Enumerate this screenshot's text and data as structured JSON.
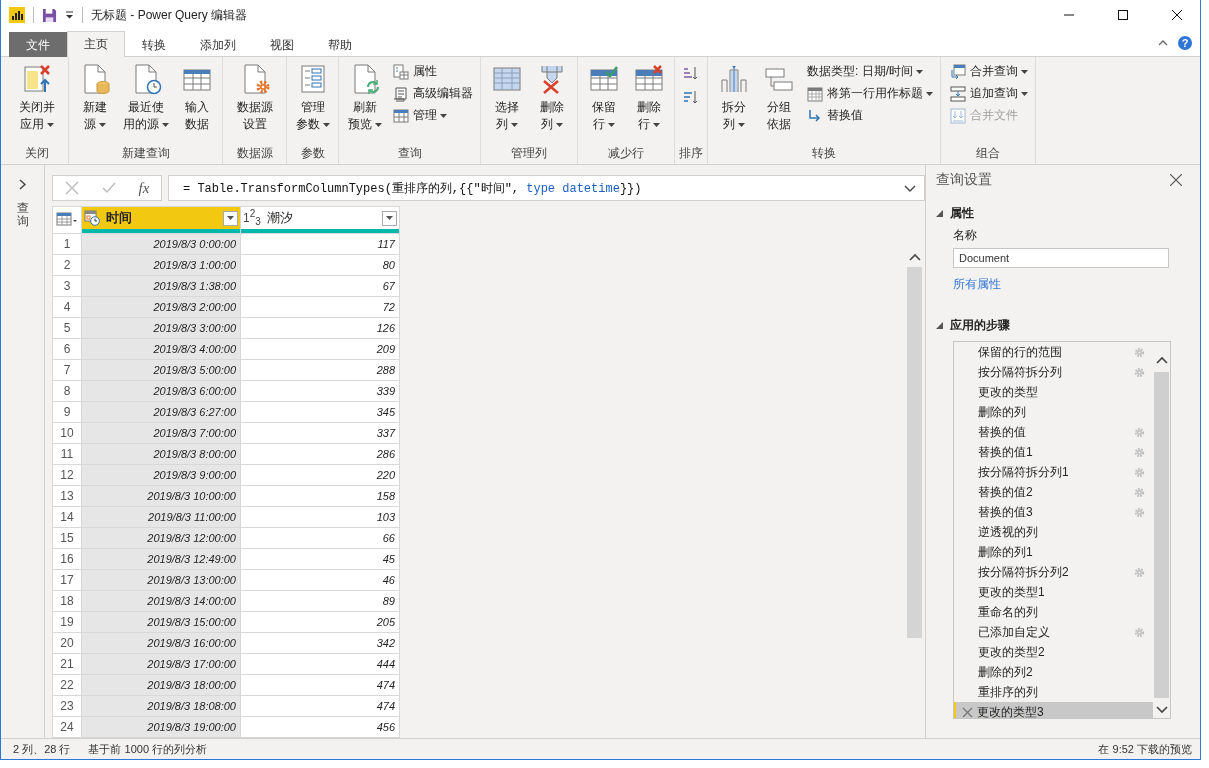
{
  "window": {
    "title": "无标题 - Power Query 编辑器"
  },
  "tabs": [
    {
      "label": "文件",
      "kind": "file",
      "selected": false
    },
    {
      "label": "主页",
      "kind": "tab",
      "selected": true
    },
    {
      "label": "转换",
      "kind": "tab",
      "selected": false
    },
    {
      "label": "添加列",
      "kind": "tab",
      "selected": false
    },
    {
      "label": "视图",
      "kind": "tab",
      "selected": false
    },
    {
      "label": "帮助",
      "kind": "tab",
      "selected": false
    }
  ],
  "help": "?",
  "ribbon": [
    {
      "label": "关闭",
      "items": [
        {
          "kind": "large",
          "label": "关闭并应用",
          "dropdown": true,
          "disabled": false
        }
      ]
    },
    {
      "label": "新建查询",
      "items": [
        {
          "kind": "large",
          "label": "新建源",
          "dropdown": true,
          "disabled": false
        },
        {
          "kind": "large",
          "label": "最近使用的源",
          "dropdown": true,
          "disabled": false
        },
        {
          "kind": "large",
          "label": "输入数据",
          "dropdown": false,
          "disabled": false
        }
      ]
    },
    {
      "label": "数据源",
      "items": [
        {
          "kind": "large",
          "label": "数据源设置",
          "dropdown": false,
          "disabled": false
        }
      ]
    },
    {
      "label": "参数",
      "items": [
        {
          "kind": "large",
          "label": "管理参数",
          "dropdown": true,
          "disabled": false
        }
      ]
    },
    {
      "label": "查询",
      "items": [
        {
          "kind": "large",
          "label": "刷新预览",
          "dropdown": true,
          "disabled": false
        },
        {
          "kind": "small",
          "label": "属性",
          "dropdown": false,
          "disabled": false
        },
        {
          "kind": "small",
          "label": "高级编辑器",
          "dropdown": false,
          "disabled": false
        },
        {
          "kind": "small",
          "label": "管理",
          "dropdown": true,
          "disabled": false
        }
      ]
    },
    {
      "label": "管理列",
      "items": [
        {
          "kind": "large",
          "label": "选择列",
          "dropdown": true,
          "disabled": false
        },
        {
          "kind": "large",
          "label": "删除列",
          "dropdown": true,
          "disabled": false
        }
      ]
    },
    {
      "label": "减少行",
      "items": [
        {
          "kind": "large",
          "label": "保留行",
          "dropdown": true,
          "disabled": false
        },
        {
          "kind": "large",
          "label": "删除行",
          "dropdown": true,
          "disabled": false
        }
      ]
    },
    {
      "label": "排序",
      "items": [
        {
          "kind": "icon",
          "dropdown": false,
          "disabled": false
        },
        {
          "kind": "icon",
          "dropdown": false,
          "disabled": false
        }
      ]
    },
    {
      "label": "转换",
      "items": [
        {
          "kind": "large",
          "label": "拆分列",
          "dropdown": true,
          "disabled": false
        },
        {
          "kind": "large",
          "label": "分组依据",
          "dropdown": false,
          "disabled": false
        },
        {
          "kind": "small",
          "label": "数据类型: 日期/时间",
          "dropdown": true,
          "disabled": false
        },
        {
          "kind": "small",
          "label": "将第一行用作标题",
          "dropdown": true,
          "disabled": false
        },
        {
          "kind": "small",
          "label": "替换值",
          "dropdown": false,
          "disabled": false
        }
      ]
    },
    {
      "label": "组合",
      "items": [
        {
          "kind": "small",
          "label": "合并查询",
          "dropdown": true,
          "disabled": false
        },
        {
          "kind": "small",
          "label": "追加查询",
          "dropdown": true,
          "disabled": false
        },
        {
          "kind": "small",
          "label": "合并文件",
          "dropdown": false,
          "disabled": true
        }
      ]
    }
  ],
  "queries_pane": {
    "label": "查询"
  },
  "formula_bar": {
    "fx": "fx",
    "tokens": [
      {
        "text": "= Table.TransformColumnTypes(重排序的列,{{\"时间\", ",
        "kind": "plain"
      },
      {
        "text": "type datetime",
        "kind": "keyword"
      },
      {
        "text": "}})",
        "kind": "plain"
      }
    ]
  },
  "table": {
    "columns": [
      {
        "name": "时间",
        "kind": "datetime",
        "selected": true
      },
      {
        "name": "潮汐",
        "kind": "number",
        "type_label": "1$^{2}$$_{3}$",
        "selected": false
      }
    ],
    "rows": [
      {
        "n": "1",
        "cells": [
          "2019/8/3 0:00:00",
          "117"
        ]
      },
      {
        "n": "2",
        "cells": [
          "2019/8/3 1:00:00",
          "80"
        ]
      },
      {
        "n": "3",
        "cells": [
          "2019/8/3 1:38:00",
          "67"
        ]
      },
      {
        "n": "4",
        "cells": [
          "2019/8/3 2:00:00",
          "72"
        ]
      },
      {
        "n": "5",
        "cells": [
          "2019/8/3 3:00:00",
          "126"
        ]
      },
      {
        "n": "6",
        "cells": [
          "2019/8/3 4:00:00",
          "209"
        ]
      },
      {
        "n": "7",
        "cells": [
          "2019/8/3 5:00:00",
          "288"
        ]
      },
      {
        "n": "8",
        "cells": [
          "2019/8/3 6:00:00",
          "339"
        ]
      },
      {
        "n": "9",
        "cells": [
          "2019/8/3 6:27:00",
          "345"
        ]
      },
      {
        "n": "10",
        "cells": [
          "2019/8/3 7:00:00",
          "337"
        ]
      },
      {
        "n": "11",
        "cells": [
          "2019/8/3 8:00:00",
          "286"
        ]
      },
      {
        "n": "12",
        "cells": [
          "2019/8/3 9:00:00",
          "220"
        ]
      },
      {
        "n": "13",
        "cells": [
          "2019/8/3 10:00:00",
          "158"
        ]
      },
      {
        "n": "14",
        "cells": [
          "2019/8/3 11:00:00",
          "103"
        ]
      },
      {
        "n": "15",
        "cells": [
          "2019/8/3 12:00:00",
          "66"
        ]
      },
      {
        "n": "16",
        "cells": [
          "2019/8/3 12:49:00",
          "45"
        ]
      },
      {
        "n": "17",
        "cells": [
          "2019/8/3 13:00:00",
          "46"
        ]
      },
      {
        "n": "18",
        "cells": [
          "2019/8/3 14:00:00",
          "89"
        ]
      },
      {
        "n": "19",
        "cells": [
          "2019/8/3 15:00:00",
          "205"
        ]
      },
      {
        "n": "20",
        "cells": [
          "2019/8/3 16:00:00",
          "342"
        ]
      },
      {
        "n": "21",
        "cells": [
          "2019/8/3 17:00:00",
          "444"
        ]
      },
      {
        "n": "22",
        "cells": [
          "2019/8/3 18:00:00",
          "474"
        ]
      },
      {
        "n": "23",
        "cells": [
          "2019/8/3 18:08:00",
          "474"
        ]
      },
      {
        "n": "24",
        "cells": [
          "2019/8/3 19:00:00",
          "456"
        ]
      }
    ]
  },
  "query_settings": {
    "title": "查询设置",
    "properties": {
      "heading": "属性",
      "expanded": true,
      "name_label": "名称",
      "name_value": "Document",
      "link": "所有属性"
    },
    "steps": {
      "heading": "应用的步骤",
      "expanded": true,
      "items": [
        {
          "label": "保留的行的范围",
          "settings": true,
          "selected": false
        },
        {
          "label": "按分隔符拆分列",
          "settings": true,
          "selected": false
        },
        {
          "label": "更改的类型",
          "settings": false,
          "selected": false
        },
        {
          "label": "删除的列",
          "settings": false,
          "selected": false
        },
        {
          "label": "替换的值",
          "settings": true,
          "selected": false
        },
        {
          "label": "替换的值1",
          "settings": true,
          "selected": false
        },
        {
          "label": "按分隔符拆分列1",
          "settings": true,
          "selected": false
        },
        {
          "label": "替换的值2",
          "settings": true,
          "selected": false
        },
        {
          "label": "替换的值3",
          "settings": true,
          "selected": false
        },
        {
          "label": "逆透视的列",
          "settings": false,
          "selected": false
        },
        {
          "label": "删除的列1",
          "settings": false,
          "selected": false
        },
        {
          "label": "按分隔符拆分列2",
          "settings": true,
          "selected": false
        },
        {
          "label": "更改的类型1",
          "settings": false,
          "selected": false
        },
        {
          "label": "重命名的列",
          "settings": false,
          "selected": false
        },
        {
          "label": "已添加自定义",
          "settings": true,
          "selected": false
        },
        {
          "label": "更改的类型2",
          "settings": false,
          "selected": false
        },
        {
          "label": "删除的列2",
          "settings": false,
          "selected": false
        },
        {
          "label": "重排序的列",
          "settings": false,
          "selected": false
        },
        {
          "label": "更改的类型3",
          "settings": false,
          "selected": true
        }
      ]
    }
  },
  "status_bar": {
    "size": "2 列、28 行",
    "profile": "基于前 1000 行的列分析",
    "preview": "在 9:52 下载的预览"
  }
}
